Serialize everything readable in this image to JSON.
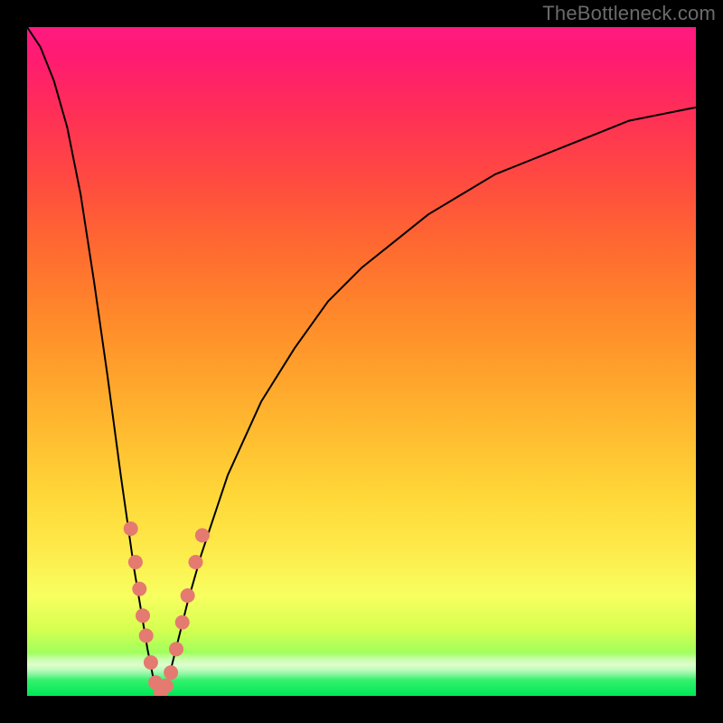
{
  "watermark": "TheBottleneck.com",
  "chart_data": {
    "type": "line",
    "title": "",
    "xlabel": "",
    "ylabel": "",
    "xlim": [
      0,
      100
    ],
    "ylim": [
      0,
      100
    ],
    "grid": false,
    "legend": false,
    "note": "Curve reaches minimum near x≈20 (y≈0). Left arm rises steeply to top-left corner; right arm rises with decreasing slope toward upper-right, reaching y≈88 at x=100.",
    "series": [
      {
        "name": "black-curve",
        "color": "#000000",
        "x": [
          0,
          2,
          4,
          6,
          8,
          10,
          12,
          14,
          16,
          18,
          19,
          20,
          21,
          22,
          24,
          26,
          30,
          35,
          40,
          45,
          50,
          55,
          60,
          65,
          70,
          75,
          80,
          85,
          90,
          95,
          100
        ],
        "y": [
          100,
          97,
          92,
          85,
          75,
          62,
          48,
          33,
          19,
          7,
          2,
          0,
          2,
          6,
          14,
          21,
          33,
          44,
          52,
          59,
          64,
          68,
          72,
          75,
          78,
          80,
          82,
          84,
          86,
          87,
          88
        ]
      }
    ],
    "markers": {
      "name": "salmon-dots",
      "color": "#e47a70",
      "points": [
        {
          "x": 15.5,
          "y": 25
        },
        {
          "x": 16.2,
          "y": 20
        },
        {
          "x": 16.8,
          "y": 16
        },
        {
          "x": 17.3,
          "y": 12
        },
        {
          "x": 17.8,
          "y": 9
        },
        {
          "x": 18.5,
          "y": 5
        },
        {
          "x": 19.2,
          "y": 2
        },
        {
          "x": 20.0,
          "y": 0.5
        },
        {
          "x": 20.8,
          "y": 1.5
        },
        {
          "x": 21.5,
          "y": 3.5
        },
        {
          "x": 22.3,
          "y": 7
        },
        {
          "x": 23.2,
          "y": 11
        },
        {
          "x": 24.0,
          "y": 15
        },
        {
          "x": 25.2,
          "y": 20
        },
        {
          "x": 26.2,
          "y": 24
        }
      ]
    }
  }
}
